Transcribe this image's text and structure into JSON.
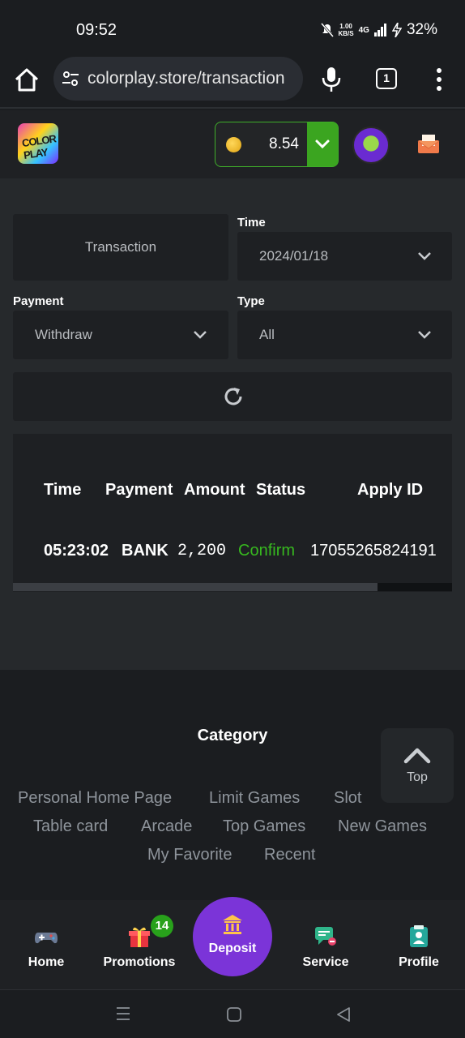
{
  "status_bar": {
    "time": "09:52",
    "speed_top": "1.00",
    "speed_bottom": "KB/S",
    "network": "4G",
    "battery": "32%"
  },
  "browser": {
    "url": "colorplay.store/transaction",
    "tab_count": "1"
  },
  "header": {
    "balance": "8.54"
  },
  "filters": {
    "transaction_label": "Transaction",
    "time_label": "Time",
    "time_value": "2024/01/18",
    "payment_label": "Payment",
    "payment_value": "Withdraw",
    "type_label": "Type",
    "type_value": "All"
  },
  "table": {
    "headers": [
      "Time",
      "Payment",
      "Amount",
      "Status",
      "Apply ID"
    ],
    "rows": [
      {
        "time": "05:23:02",
        "payment": "BANK",
        "amount": "2,200",
        "status": "Confirm",
        "apply_id": "17055265824191"
      }
    ],
    "status_color": "#37b81f",
    "scroll_fraction": 0.83
  },
  "category": {
    "title": "Category",
    "links": [
      "Personal Home Page",
      "Limit Games",
      "Slot",
      "Table card",
      "Arcade",
      "Top Games",
      "New Games",
      "My Favorite",
      "Recent"
    ]
  },
  "top_button": {
    "label": "Top"
  },
  "bottom_nav": {
    "home": "Home",
    "promotions": "Promotions",
    "promotions_badge": "14",
    "deposit": "Deposit",
    "service": "Service",
    "profile": "Profile"
  },
  "colors": {
    "accent_green": "#3ba520",
    "deposit_purple": "#7b34d8",
    "background": "#1b1d20"
  },
  "icons": [
    "home-icon",
    "tune-icon",
    "mic-icon",
    "tabs-icon",
    "more-vert-icon",
    "coin-icon",
    "chevron-down-icon",
    "mail-icon",
    "refresh-icon",
    "chevron-up-icon",
    "gamepad-icon",
    "gift-icon",
    "bank-icon",
    "chat-icon",
    "profile-icon"
  ]
}
